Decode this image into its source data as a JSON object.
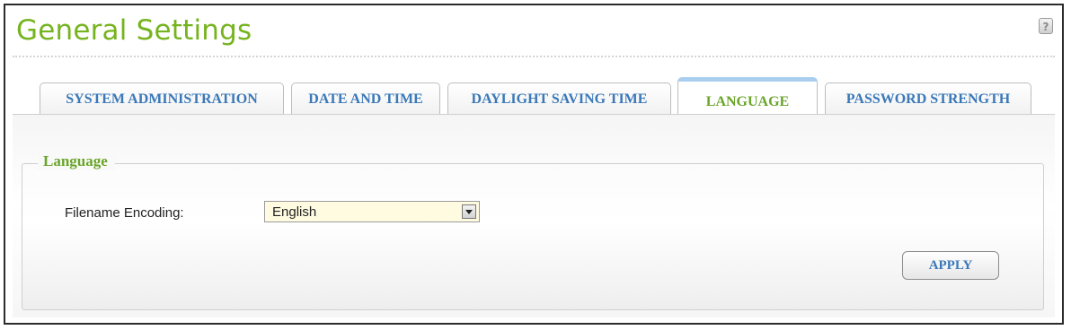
{
  "header": {
    "title": "General Settings",
    "help_icon": "help-icon",
    "help_label": "?"
  },
  "tabs": [
    {
      "label": "SYSTEM ADMINISTRATION",
      "active": false
    },
    {
      "label": "DATE AND TIME",
      "active": false
    },
    {
      "label": "DAYLIGHT SAVING TIME",
      "active": false
    },
    {
      "label": "LANGUAGE",
      "active": true
    },
    {
      "label": "PASSWORD STRENGTH",
      "active": false
    }
  ],
  "language_section": {
    "legend": "Language",
    "filename_encoding": {
      "label": "Filename Encoding:",
      "value": "English",
      "dropdown_icon": "chevron-down-icon"
    },
    "apply_label": "APPLY"
  },
  "colors": {
    "title": "#76b41f",
    "tab_text": "#3a78b8",
    "active_tab_text": "#6aa52a",
    "active_tab_accent": "#aacfee",
    "select_background": "#fffbe0"
  }
}
